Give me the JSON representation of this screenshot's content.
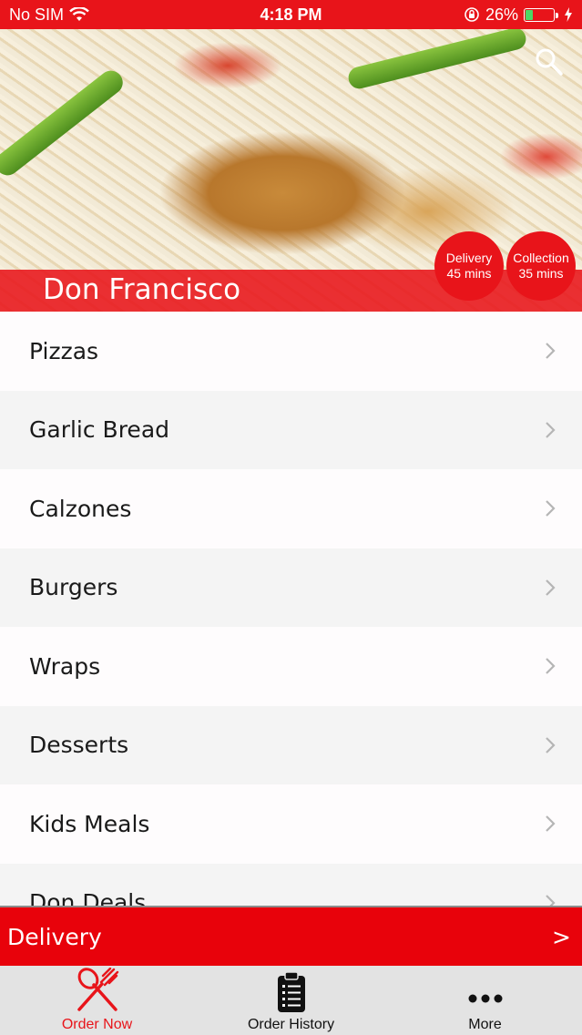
{
  "status_bar": {
    "carrier": "No SIM",
    "time": "4:18 PM",
    "battery_percent": "26%",
    "battery_level": 0.26,
    "icons": [
      "wifi-icon",
      "rotation-lock-icon",
      "battery-icon",
      "charging-icon"
    ]
  },
  "header": {
    "restaurant_name": "Don Francisco",
    "search_icon": "search-icon",
    "delivery_badge": {
      "label": "Delivery",
      "time": "45 mins"
    },
    "collection_badge": {
      "label": "Collection",
      "time": "35 mins"
    }
  },
  "menu": {
    "items": [
      {
        "label": "Pizzas"
      },
      {
        "label": "Garlic Bread"
      },
      {
        "label": "Calzones"
      },
      {
        "label": "Burgers"
      },
      {
        "label": "Wraps"
      },
      {
        "label": "Desserts"
      },
      {
        "label": "Kids Meals"
      },
      {
        "label": "Don Deals"
      }
    ]
  },
  "order_bar": {
    "label": "Delivery",
    "arrow": ">"
  },
  "tab_bar": {
    "tabs": [
      {
        "label": "Order Now",
        "icon": "fork-knife-icon",
        "active": true
      },
      {
        "label": "Order History",
        "icon": "clipboard-icon",
        "active": false
      },
      {
        "label": "More",
        "icon": "more-dots-icon",
        "active": false
      }
    ]
  },
  "colors": {
    "brand_red": "#e8141a",
    "active_tab": "#e8141a",
    "inactive_tab": "#111111"
  }
}
